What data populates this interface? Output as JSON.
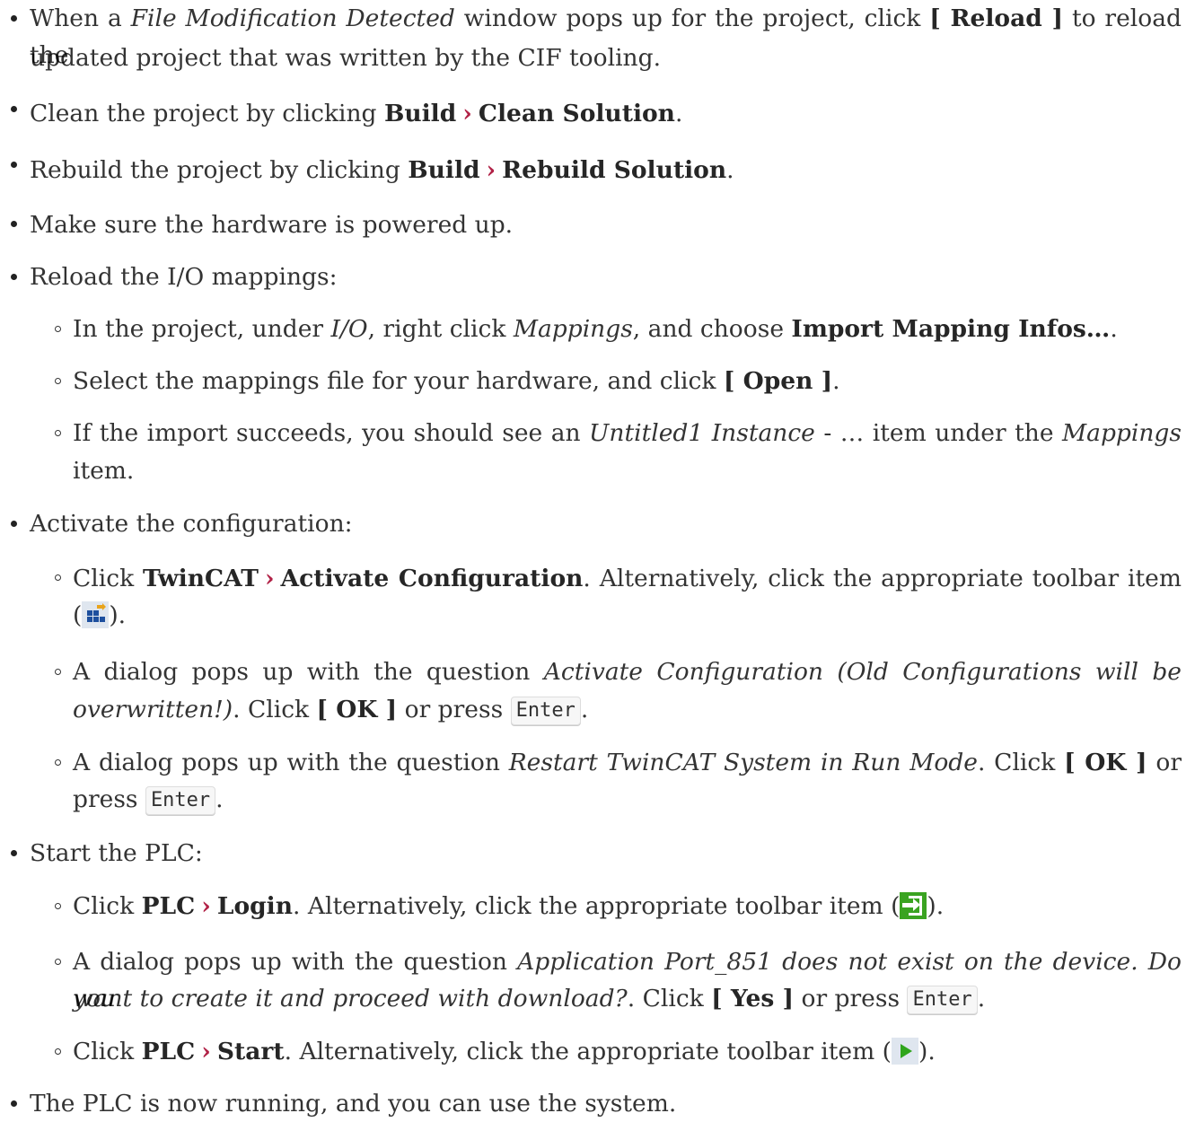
{
  "items": {
    "reload": {
      "line1_a": "When a ",
      "line1_b": "File Modification Detected",
      "line1_c": " window pops up for the project, click ",
      "line1_d": "[ Reload ]",
      "line1_e": " to reload the",
      "line2": "updated project that was written by the CIF tooling."
    },
    "clean": {
      "a": "Clean the project by clicking ",
      "b": "Build",
      "sep": "›",
      "c": "Clean Solution",
      "d": "."
    },
    "rebuild": {
      "a": "Rebuild the project by clicking ",
      "b": "Build",
      "sep": "›",
      "c": "Rebuild Solution",
      "d": "."
    },
    "powered": "Make sure the hardware is powered up.",
    "mappings": {
      "title": "Reload the I/O mappings:",
      "s1": {
        "a": "In the project, under ",
        "b": "I/O",
        "c": ", right click ",
        "d": "Mappings",
        "e": ", and choose ",
        "f": "Import Mapping Infos…",
        "g": "."
      },
      "s2": {
        "a": "Select the mappings file for your hardware, and click ",
        "b": "[ Open ]",
        "c": "."
      },
      "s3": {
        "a": "If the import succeeds, you should see an ",
        "b": "Untitled1 Instance",
        "c": " - … item under the ",
        "d": "Mappings",
        "e": "item."
      }
    },
    "activate": {
      "title": "Activate the configuration:",
      "s1": {
        "a": "Click ",
        "b": "TwinCAT",
        "sep": "›",
        "c": "Activate Configuration",
        "d": ". Alternatively, click the appropriate toolbar item",
        "e": "(",
        "icon": "activate-configuration-icon",
        "f": ")."
      },
      "s2": {
        "a": "A dialog pops up with the question ",
        "b": "Activate Configuration (Old Configurations will be",
        "c": "overwritten!)",
        "d": ". Click ",
        "e": "[ OK ]",
        "f": " or press ",
        "key": "Enter",
        "g": "."
      },
      "s3": {
        "a": "A dialog pops up with the question ",
        "b": "Restart TwinCAT System in Run Mode",
        "c": ". Click ",
        "d": "[ OK ]",
        "e": " or",
        "f": "press ",
        "key": "Enter",
        "g": "."
      }
    },
    "plc": {
      "title": "Start the PLC:",
      "s1": {
        "a": "Click ",
        "b": "PLC",
        "sep": "›",
        "c": "Login",
        "d": ". Alternatively, click the appropriate toolbar item (",
        "icon": "login-icon",
        "e": ")."
      },
      "s2": {
        "a": "A dialog pops up with the question ",
        "b": "Application Port_851 does not exist on the device. Do you",
        "c": "want to create it and proceed with download?",
        "d": ". Click ",
        "e": "[ Yes ]",
        "f": " or press ",
        "key": "Enter",
        "g": "."
      },
      "s3": {
        "a": "Click ",
        "b": "PLC",
        "sep": "›",
        "c": "Start",
        "d": ". Alternatively, click the appropriate toolbar item (",
        "icon": "start-icon",
        "e": ")."
      }
    },
    "running": "The PLC is now running, and you can use the system."
  },
  "colors": {
    "menu_separator": "#b12146",
    "text": "#333333"
  }
}
